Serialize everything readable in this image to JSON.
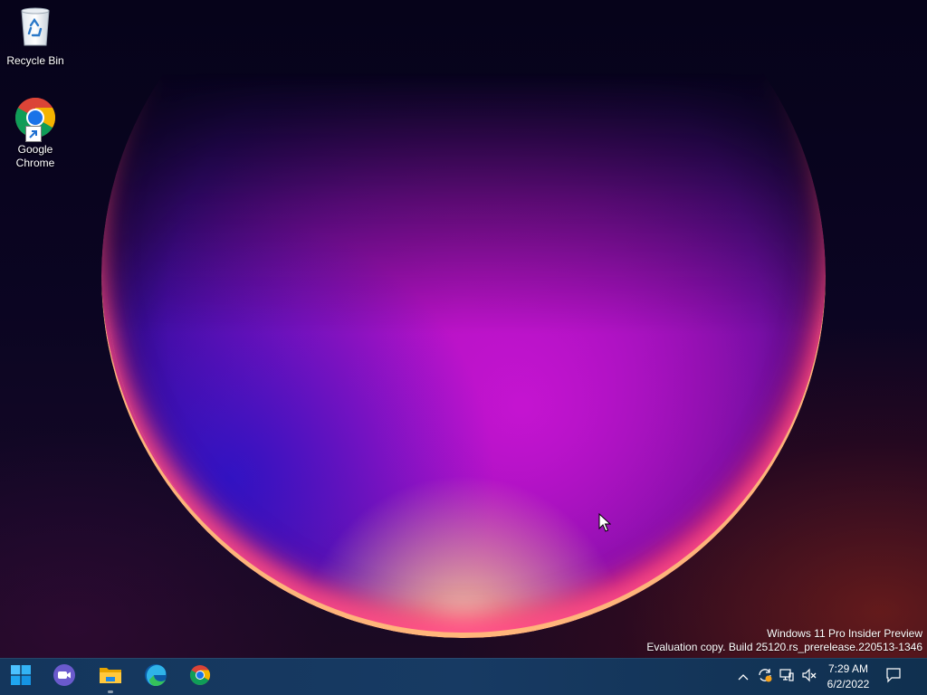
{
  "desktop": {
    "icons": [
      {
        "label": "Recycle Bin",
        "icon": "recycle-bin-icon"
      },
      {
        "label": "Google\nChrome",
        "icon": "chrome-icon",
        "shortcut": true
      }
    ],
    "watermark": {
      "line1": "Windows 11 Pro Insider Preview",
      "line2": "Evaluation copy. Build 25120.rs_prerelease.220513-1346"
    }
  },
  "taskbar": {
    "pinned": [
      {
        "name": "Start",
        "icon": "windows-logo-icon"
      },
      {
        "name": "Meet",
        "icon": "video-camera-icon"
      },
      {
        "name": "File Explorer",
        "icon": "folder-icon"
      },
      {
        "name": "Microsoft Edge",
        "icon": "edge-icon"
      },
      {
        "name": "Google Chrome",
        "icon": "chrome-icon"
      }
    ],
    "tray": {
      "icons": [
        "chevron-up-icon",
        "sync-icon",
        "network-icon",
        "volume-muted-icon"
      ],
      "time": "7:29 AM",
      "date": "6/2/2022"
    }
  },
  "colors": {
    "taskbar": "#173a63",
    "accent_blue": "#0a78d4"
  }
}
